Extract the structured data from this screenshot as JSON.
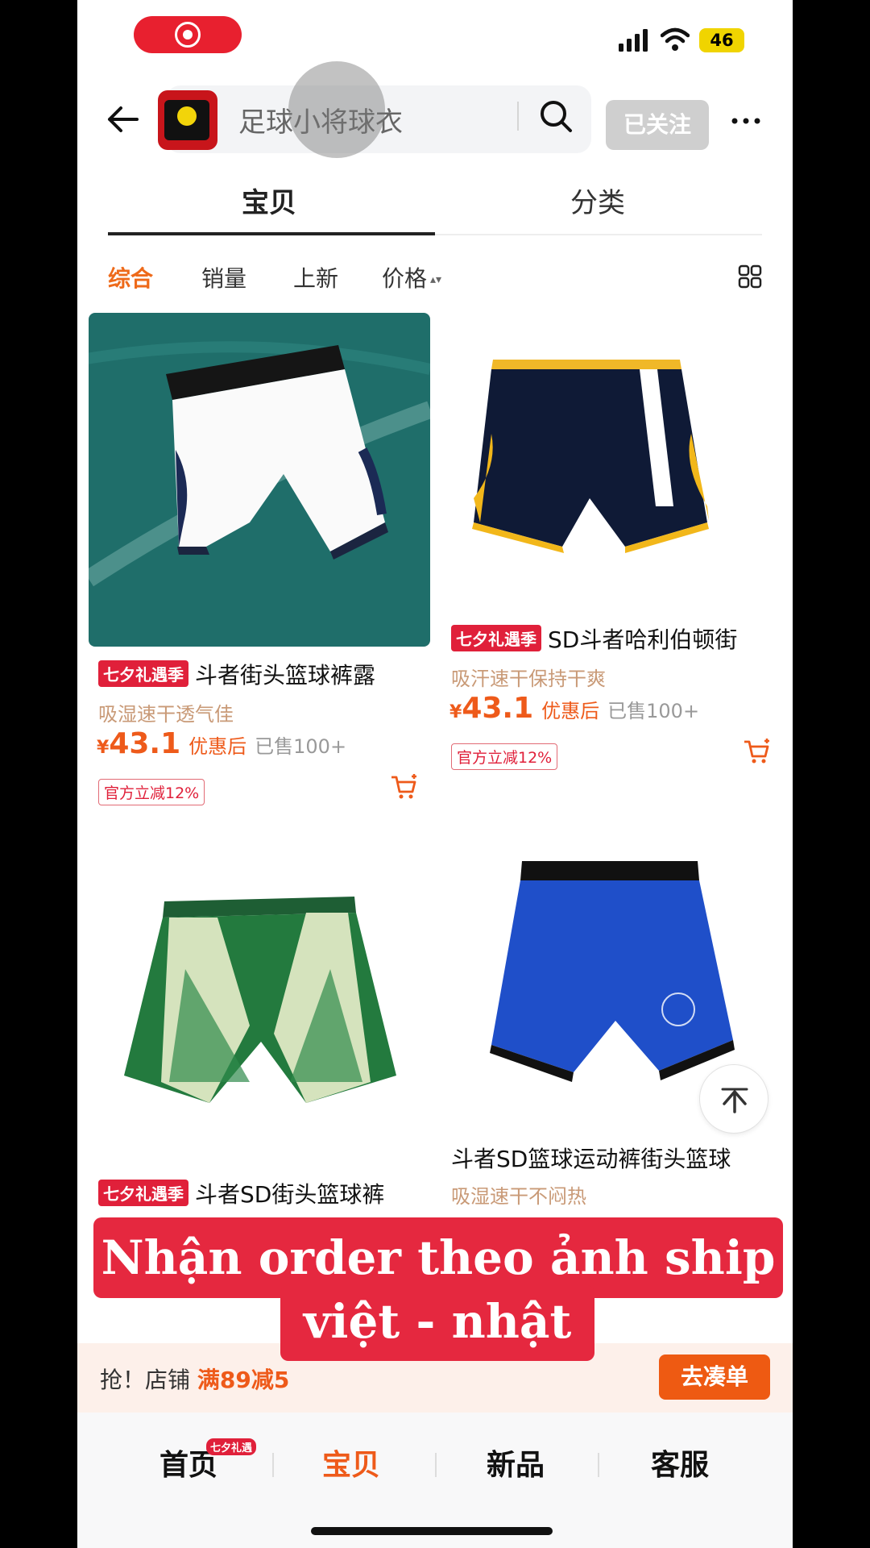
{
  "status_bar": {
    "battery": "46"
  },
  "header": {
    "search_text": "足球小将球衣",
    "follow_label": "已关注"
  },
  "tabs": [
    {
      "label": "宝贝"
    },
    {
      "label": "分类"
    }
  ],
  "filters": [
    {
      "label": "综合"
    },
    {
      "label": "销量"
    },
    {
      "label": "上新"
    },
    {
      "label": "价格"
    }
  ],
  "products": [
    {
      "badge": "七夕礼遇季",
      "title": "斗者街头篮球裤露",
      "subtitle": "吸湿速干透气佳",
      "currency": "¥",
      "price": "43.1",
      "price_note": "优惠后",
      "sold": "已售100+",
      "coupon": "官方立减12%"
    },
    {
      "badge": "七夕礼遇季",
      "title": "SD斗者哈利伯顿街",
      "subtitle": "吸汗速干保持干爽",
      "currency": "¥",
      "price": "43.1",
      "price_note": "优惠后",
      "sold": "已售100+",
      "coupon": "官方立减12%"
    },
    {
      "badge": "七夕礼遇季",
      "title": "斗者SD街头篮球裤"
    },
    {
      "title": "斗者SD篮球运动裤街头篮球",
      "subtitle": "吸湿速干不闷热"
    }
  ],
  "caption": {
    "line1": "Nhận order theo ảnh ship",
    "line2": "việt - nhật"
  },
  "promo_bar": {
    "prefix": "抢！店铺",
    "highlight": "满89减5",
    "button": "去凑单"
  },
  "bottom_nav": [
    {
      "label": "首页",
      "badge": "七夕礼遇"
    },
    {
      "label": "宝贝"
    },
    {
      "label": "新品"
    },
    {
      "label": "客服"
    }
  ],
  "colors": {
    "accent": "#ee5a1a",
    "promo_red": "#e0203a",
    "caption_red": "#e5283f"
  }
}
